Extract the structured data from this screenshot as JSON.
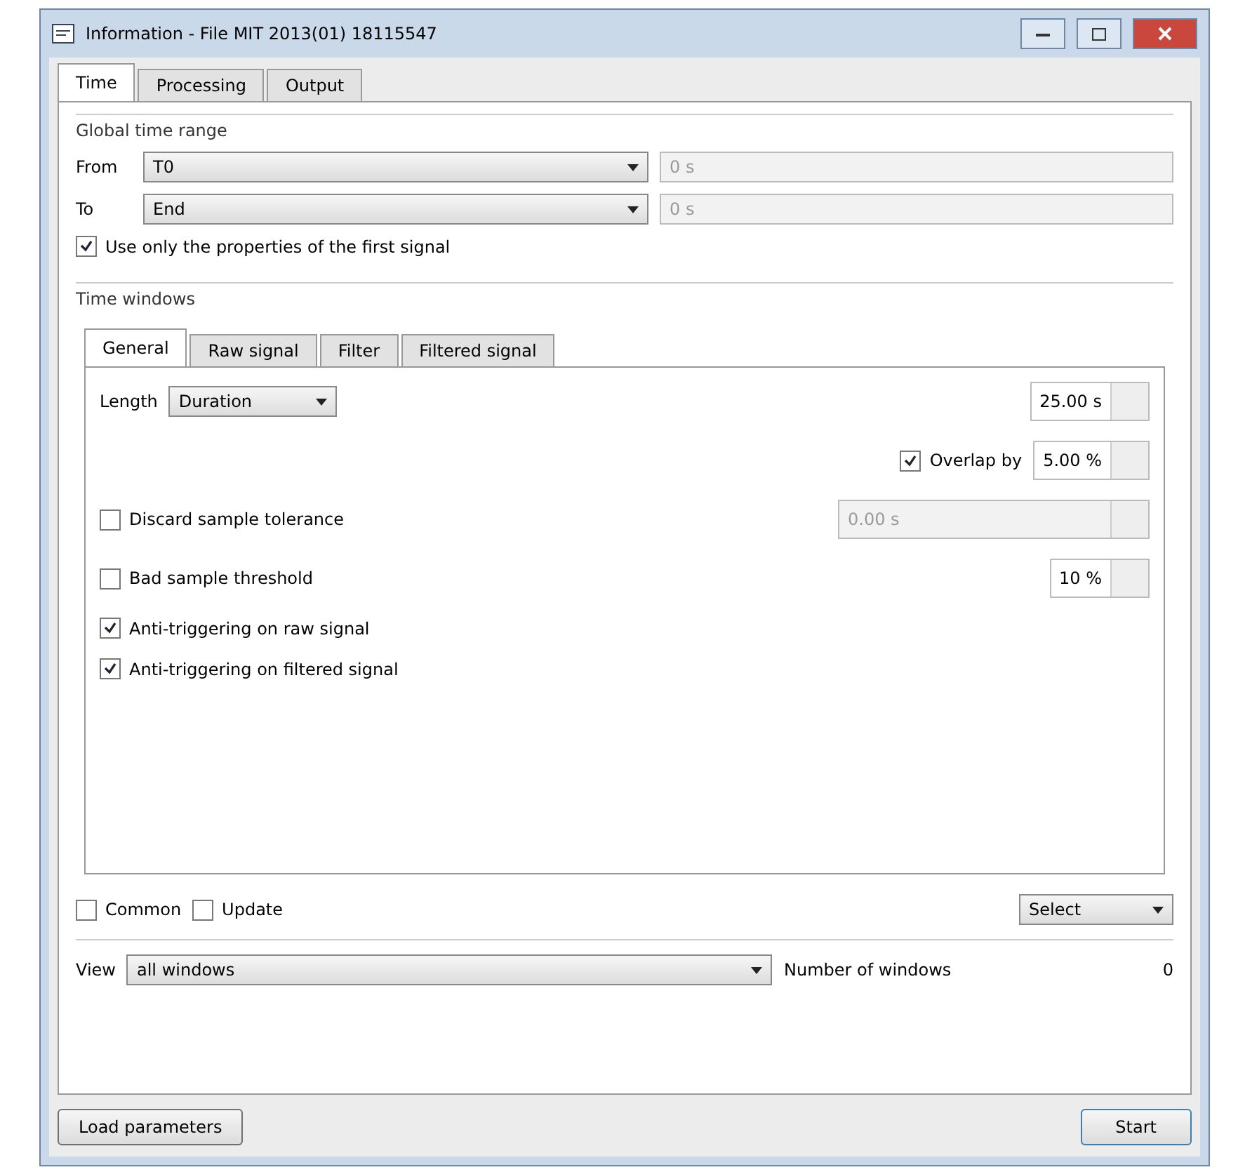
{
  "window": {
    "title": "Information - File MIT 2013(01) 18115547"
  },
  "tabs": [
    {
      "label": "Time",
      "selected": true
    },
    {
      "label": "Processing",
      "selected": false
    },
    {
      "label": "Output",
      "selected": false
    }
  ],
  "global_time_range": {
    "title": "Global time range",
    "from": {
      "label": "From",
      "value": "T0",
      "time": "0 s"
    },
    "to": {
      "label": "To",
      "value": "End",
      "time": "0 s"
    },
    "first_signal": {
      "label": "Use only the properties of the first signal",
      "checked": true
    }
  },
  "time_windows": {
    "title": "Time windows",
    "tabs": [
      {
        "label": "General",
        "selected": true
      },
      {
        "label": "Raw signal",
        "selected": false
      },
      {
        "label": "Filter",
        "selected": false
      },
      {
        "label": "Filtered signal",
        "selected": false
      }
    ],
    "length": {
      "label": "Length",
      "value": "Duration",
      "reading": "25.00 s"
    },
    "overlap": {
      "label": "Overlap by",
      "checked": true,
      "value": "5.00 %"
    },
    "options": [
      {
        "label": "Discard sample tolerance",
        "checked": false,
        "value": "0.00 s",
        "disabled": true
      },
      {
        "label": "Bad sample threshold",
        "checked": false,
        "value": "10 %",
        "disabled": false
      },
      {
        "label": "Anti-triggering on raw signal",
        "checked": true
      },
      {
        "label": "Anti-triggering on filtered signal",
        "checked": true
      }
    ],
    "common": {
      "label": "Common",
      "checked": false
    },
    "update": {
      "label": "Update",
      "checked": false
    },
    "select_button": "Select"
  },
  "view": {
    "label": "View",
    "value": "all windows",
    "count_label": "Number of windows",
    "count": "0"
  },
  "buttons": {
    "load": "Load parameters",
    "start": "Start"
  }
}
